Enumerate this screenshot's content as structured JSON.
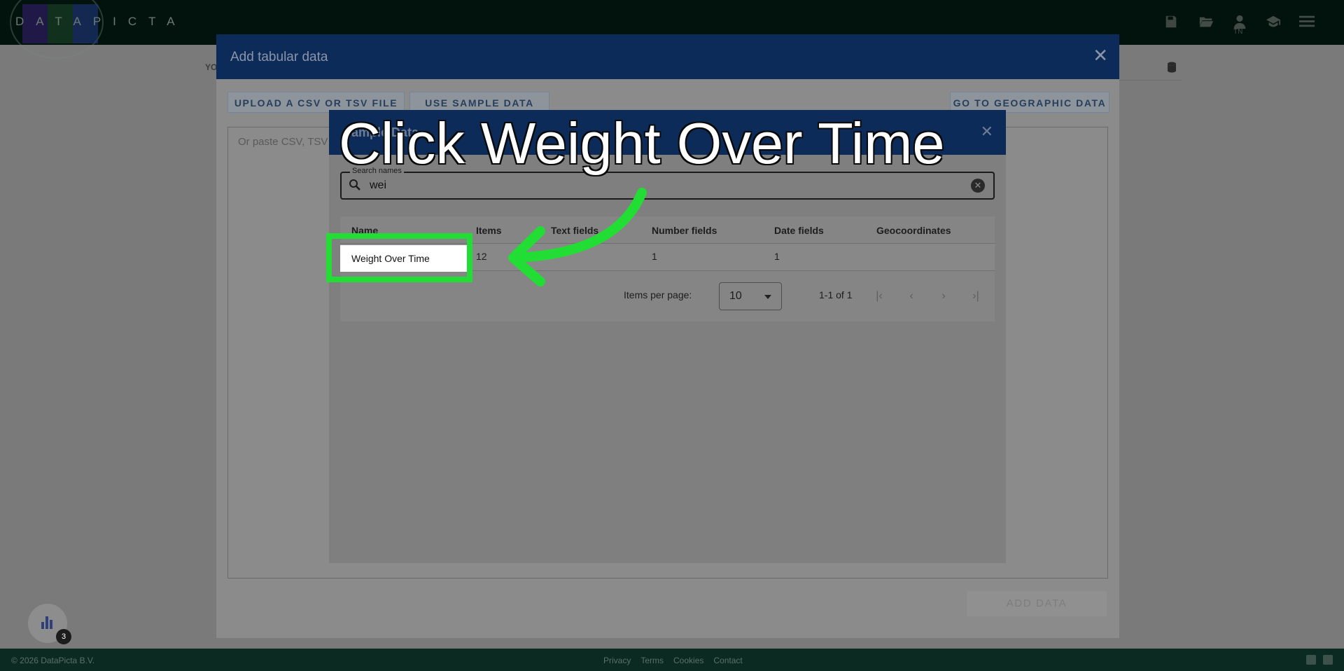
{
  "brand": {
    "logo_text": "DATAPICTA",
    "logo_colors": [
      "#3a1e78",
      "#1f4c2e",
      "#233b8a"
    ]
  },
  "topbar": {
    "user_initials": "TN"
  },
  "background": {
    "section_label": "YO"
  },
  "main_dialog": {
    "title": "Add tabular data",
    "buttons": {
      "upload": "UPLOAD A CSV OR TSV FILE",
      "sample": "USE SAMPLE DATA",
      "geo": "GO TO GEOGRAPHIC DATA",
      "add": "ADD DATA"
    },
    "paste_placeholder": "Or paste CSV, TSV"
  },
  "sample_dialog": {
    "title": "Sample Data",
    "search": {
      "label": "Search names",
      "value": "wei"
    },
    "table": {
      "columns": [
        "Name",
        "Items",
        "Text fields",
        "Number fields",
        "Date fields",
        "Geocoordinates"
      ],
      "rows": [
        {
          "name": "Weight Over Time",
          "items": "12",
          "text_fields": "",
          "number_fields": "1",
          "date_fields": "1",
          "geocoordinates": ""
        }
      ]
    },
    "pagination": {
      "items_per_page_label": "Items per page:",
      "items_per_page": "10",
      "range": "1-1 of 1"
    }
  },
  "tutorial": {
    "instruction": "Click Weight Over Time",
    "highlight_color": "#22dd33"
  },
  "fab": {
    "badge_count": "3"
  },
  "footer": {
    "copyright": "© 2026 DataPicta B.V.",
    "links": [
      "Privacy",
      "Terms",
      "Cookies",
      "Contact"
    ]
  }
}
